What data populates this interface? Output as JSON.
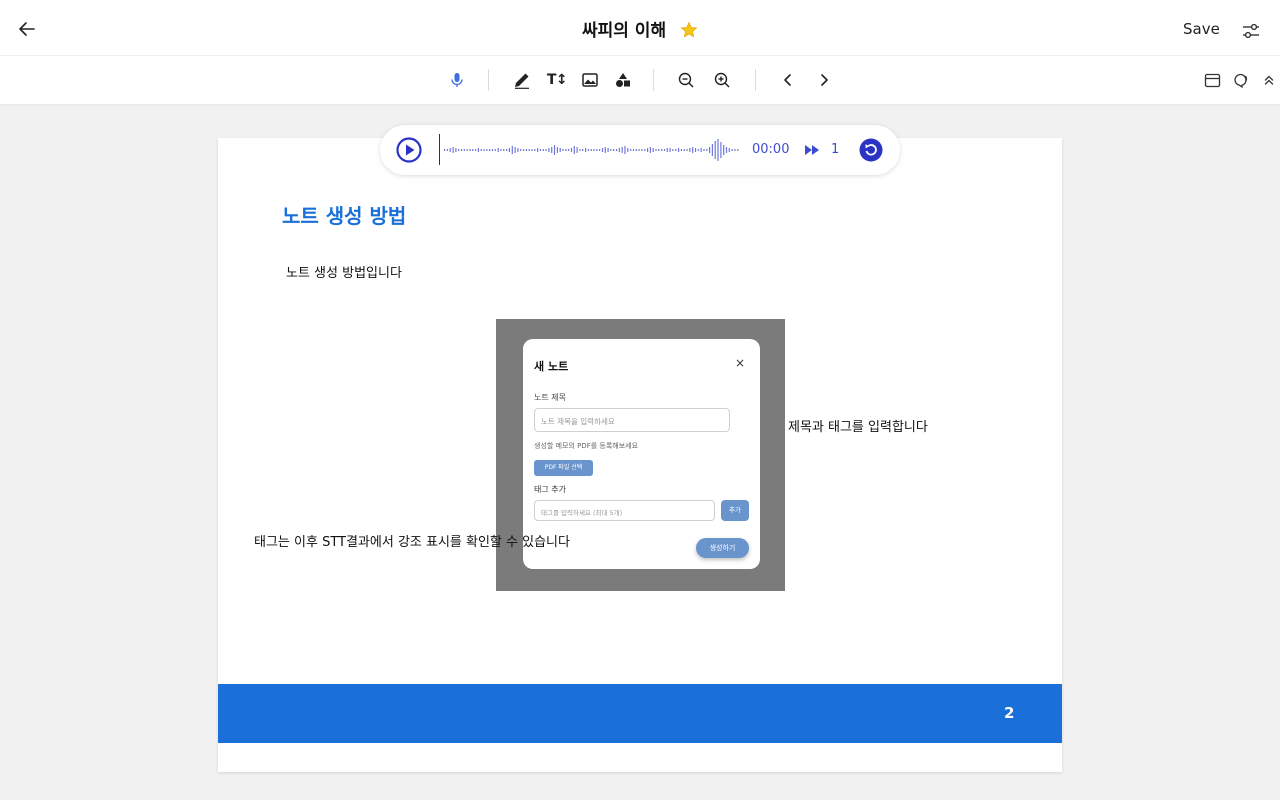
{
  "header": {
    "title": "싸피의 이해",
    "save_label": "Save",
    "icons": [
      "arrow-left-icon",
      "star-icon",
      "sliders-icon"
    ],
    "star_color": "#f5c518"
  },
  "toolbar": {
    "text_tool_label": "T↕",
    "icons": [
      "microphone-icon",
      "pen-icon",
      "text-size-icon",
      "image-icon",
      "shapes-icon",
      "zoom-out-icon",
      "zoom-in-icon",
      "chevron-left-icon",
      "chevron-right-icon",
      "layout-icon",
      "speech-icon",
      "chevron-up-double-icon"
    ],
    "active_color": "#3d6fe0"
  },
  "player": {
    "time": "00:00",
    "speed": "1",
    "accent_color": "#3d4ccf"
  },
  "page": {
    "heading": "노트 생성 방법",
    "body": "노트 생성 방법입니다",
    "callout_right": "제목과 태그를 입력합니다",
    "callout_left": "태그는 이후 STT결과에서 강조 표시를 확인할 수 있습니다",
    "page_number": "2",
    "brand_color": "#1a6fd8"
  },
  "modal": {
    "title": "새 노트",
    "close": "×",
    "title_label": "노트 제목",
    "title_placeholder": "노트 제목을 입력하세요",
    "pdf_desc": "생성할 메모의 PDF를 등록해보세요",
    "pdf_button": "PDF 파일 선택",
    "tag_label": "태그 추가",
    "tag_placeholder": "태그를 입력하세요 (최대 5개)",
    "add_button": "추가",
    "create_button": "생성하기"
  }
}
